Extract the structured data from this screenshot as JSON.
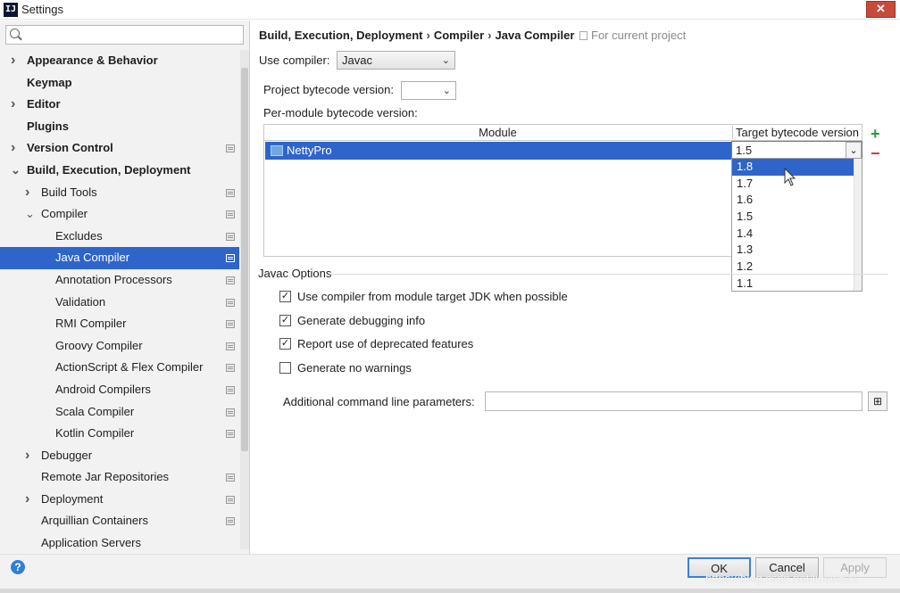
{
  "window": {
    "title": "Settings",
    "app_icon_text": "IJ",
    "close_label": "✕"
  },
  "sidebar": {
    "search_placeholder": "",
    "items": [
      {
        "label": "Appearance & Behavior"
      },
      {
        "label": "Keymap"
      },
      {
        "label": "Editor"
      },
      {
        "label": "Plugins"
      },
      {
        "label": "Version Control"
      },
      {
        "label": "Build, Execution, Deployment"
      },
      {
        "label": "Build Tools"
      },
      {
        "label": "Compiler"
      },
      {
        "label": "Excludes"
      },
      {
        "label": "Java Compiler"
      },
      {
        "label": "Annotation Processors"
      },
      {
        "label": "Validation"
      },
      {
        "label": "RMI Compiler"
      },
      {
        "label": "Groovy Compiler"
      },
      {
        "label": "ActionScript & Flex Compiler"
      },
      {
        "label": "Android Compilers"
      },
      {
        "label": "Scala Compiler"
      },
      {
        "label": "Kotlin Compiler"
      },
      {
        "label": "Debugger"
      },
      {
        "label": "Remote Jar Repositories"
      },
      {
        "label": "Deployment"
      },
      {
        "label": "Arquillian Containers"
      },
      {
        "label": "Application Servers"
      }
    ],
    "selected": "Java Compiler"
  },
  "breadcrumb": {
    "parts": [
      "Build, Execution, Deployment",
      "Compiler",
      "Java Compiler"
    ],
    "separator": "›",
    "scope": "For current project"
  },
  "compiler": {
    "use_compiler_label": "Use compiler:",
    "use_compiler_value": "Javac",
    "project_bytecode_label": "Project bytecode version:",
    "project_bytecode_value": "",
    "per_module_label": "Per-module bytecode version:"
  },
  "module_table": {
    "columns": [
      "Module",
      "Target bytecode version"
    ],
    "rows": [
      {
        "module": "NettyPro",
        "target": "1.5"
      }
    ]
  },
  "target_dropdown": {
    "options": [
      "1.8",
      "1.7",
      "1.6",
      "1.5",
      "1.4",
      "1.3",
      "1.2",
      "1.1"
    ],
    "highlighted": "1.8"
  },
  "javac_options": {
    "title": "Javac Options",
    "checkboxes": [
      {
        "label": "Use compiler from module target JDK when possible",
        "checked": true
      },
      {
        "label": "Generate debugging info",
        "checked": true
      },
      {
        "label": "Report use of deprecated features",
        "checked": true
      },
      {
        "label": "Generate no warnings",
        "checked": false
      }
    ],
    "params_label": "Additional command line parameters:",
    "params_value": ""
  },
  "buttons": {
    "ok": "OK",
    "cancel": "Cancel",
    "apply": "Apply"
  },
  "watermark": "https://blog.csdn.net/lidew521",
  "colors": {
    "selection": "#2f65ca",
    "add": "#2e9a3e",
    "remove": "#d23a3a",
    "close": "#c74a3b"
  }
}
